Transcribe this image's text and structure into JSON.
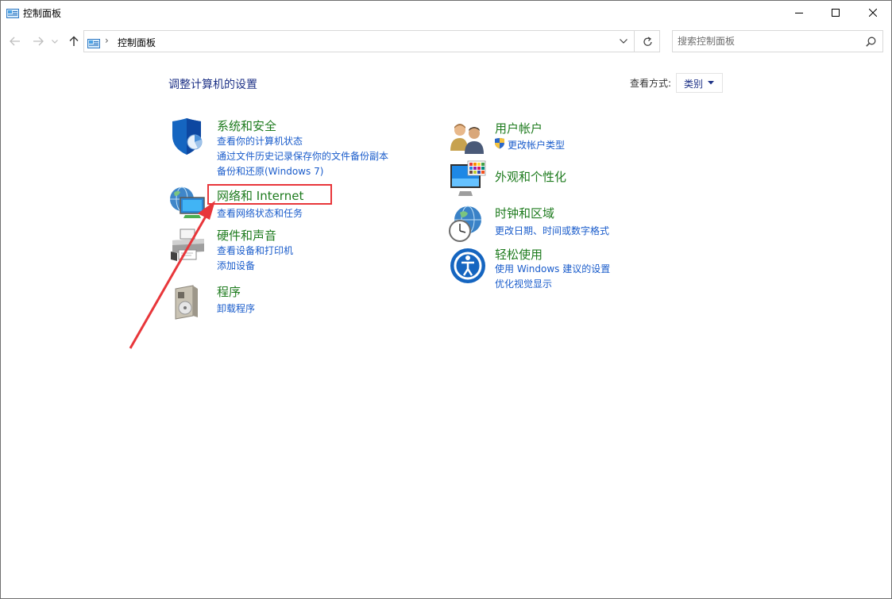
{
  "window": {
    "title": "控制面板",
    "minimize_icon": "minimize-icon",
    "maximize_icon": "maximize-icon",
    "close_icon": "close-icon"
  },
  "nav": {
    "breadcrumb_sep": "›",
    "breadcrumb": "控制面板",
    "search_placeholder": "搜索控制面板"
  },
  "content": {
    "heading": "调整计算机的设置",
    "view_by_label": "查看方式:",
    "view_by_value": "类别"
  },
  "categories": {
    "system_security": {
      "title": "系统和安全",
      "links": [
        "查看你的计算机状态",
        "通过文件历史记录保存你的文件备份副本",
        "备份和还原(Windows 7)"
      ],
      "icon": "shield-icon"
    },
    "network": {
      "title": "网络和 Internet",
      "links": [
        "查看网络状态和任务"
      ],
      "icon": "network-globe-icon"
    },
    "hardware": {
      "title": "硬件和声音",
      "links": [
        "查看设备和打印机",
        "添加设备"
      ],
      "icon": "printer-icon"
    },
    "programs": {
      "title": "程序",
      "links": [
        "卸载程序"
      ],
      "icon": "programs-icon"
    },
    "user_accounts": {
      "title": "用户帐户",
      "links": [
        "更改帐户类型"
      ],
      "icon": "users-icon"
    },
    "appearance": {
      "title": "外观和个性化",
      "links": [],
      "icon": "monitor-palette-icon"
    },
    "clock_region": {
      "title": "时钟和区域",
      "links": [
        "更改日期、时间或数字格式"
      ],
      "icon": "clock-globe-icon"
    },
    "ease_of_access": {
      "title": "轻松使用",
      "links": [
        "使用 Windows 建议的设置",
        "优化视觉显示"
      ],
      "icon": "ease-of-access-icon"
    }
  },
  "colors": {
    "heading": "#1e3287",
    "category_title": "#1e7b1e",
    "link": "#1a5ccb",
    "annotation": "#e8363a"
  }
}
